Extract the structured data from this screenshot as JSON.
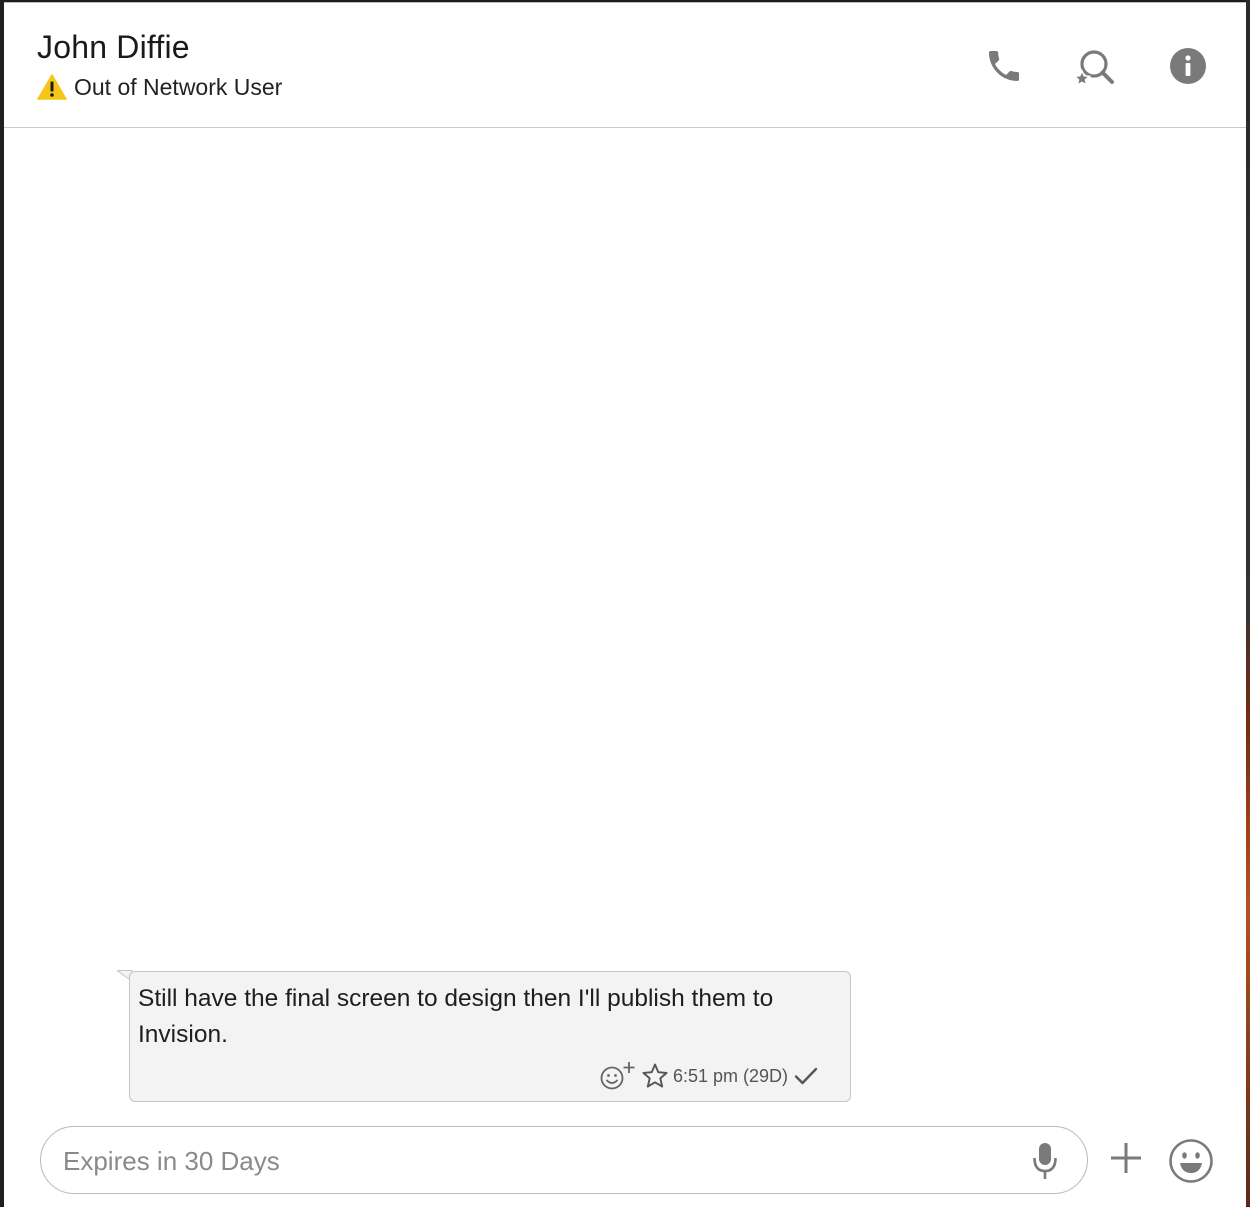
{
  "header": {
    "contact_name": "John Diffie",
    "status_text": "Out of Network User",
    "icons": {
      "status": "warning-icon",
      "call": "phone-icon",
      "search": "starred-search-icon",
      "info": "info-icon"
    }
  },
  "messages": [
    {
      "text": "Still have the final screen to design then I'll publish them to Invision.",
      "time": "6:51 pm (29D)",
      "icons": [
        "add-reaction-icon",
        "star-icon",
        "checkmark-icon"
      ]
    }
  ],
  "composer": {
    "placeholder": "Expires in 30 Days",
    "value": "",
    "icons": [
      "microphone-icon",
      "plus-icon",
      "emoji-icon"
    ]
  },
  "colors": {
    "warning": "#f5c518",
    "icon_gray": "#7a7a7a",
    "bubble_bg": "#f3f3f3",
    "border": "#c6c6c6"
  }
}
